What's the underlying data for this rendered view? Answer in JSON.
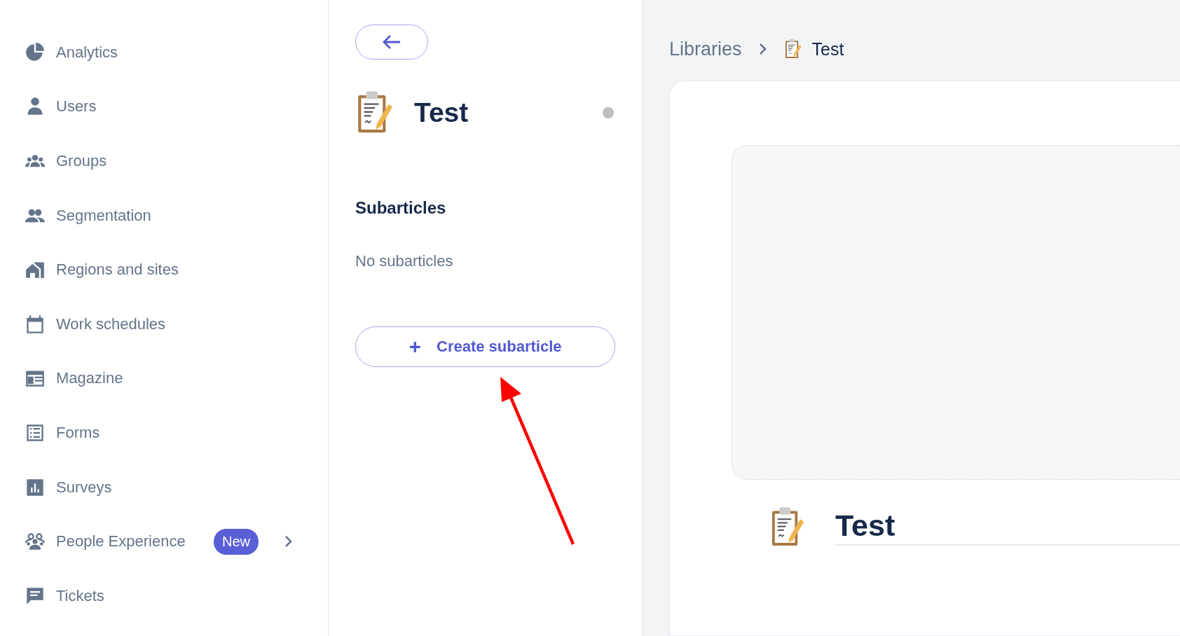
{
  "sidebar": {
    "items": [
      {
        "label": "Analytics",
        "kind": "pie"
      },
      {
        "label": "Users",
        "kind": "user"
      },
      {
        "label": "Groups",
        "kind": "groups"
      },
      {
        "label": "Segmentation",
        "kind": "people"
      },
      {
        "label": "Regions and sites",
        "kind": "building"
      },
      {
        "label": "Work schedules",
        "kind": "calendar"
      },
      {
        "label": "Magazine",
        "kind": "newspaper"
      },
      {
        "label": "Forms",
        "kind": "list"
      },
      {
        "label": "Surveys",
        "kind": "chart"
      },
      {
        "label": "People Experience",
        "kind": "team",
        "badge": "New",
        "expandable": true
      },
      {
        "label": "Tickets",
        "kind": "message"
      }
    ]
  },
  "detail": {
    "title": "Test",
    "status_dot": {
      "color": "#bdbdbd"
    },
    "section_title": "Subarticles",
    "empty_text": "No subarticles",
    "create_button": {
      "icon": "+",
      "label": "Create subarticle"
    }
  },
  "breadcrumb": [
    {
      "label": "Libraries",
      "current": false
    },
    {
      "label": "Test",
      "current": true
    }
  ],
  "article": {
    "title": "Test"
  }
}
